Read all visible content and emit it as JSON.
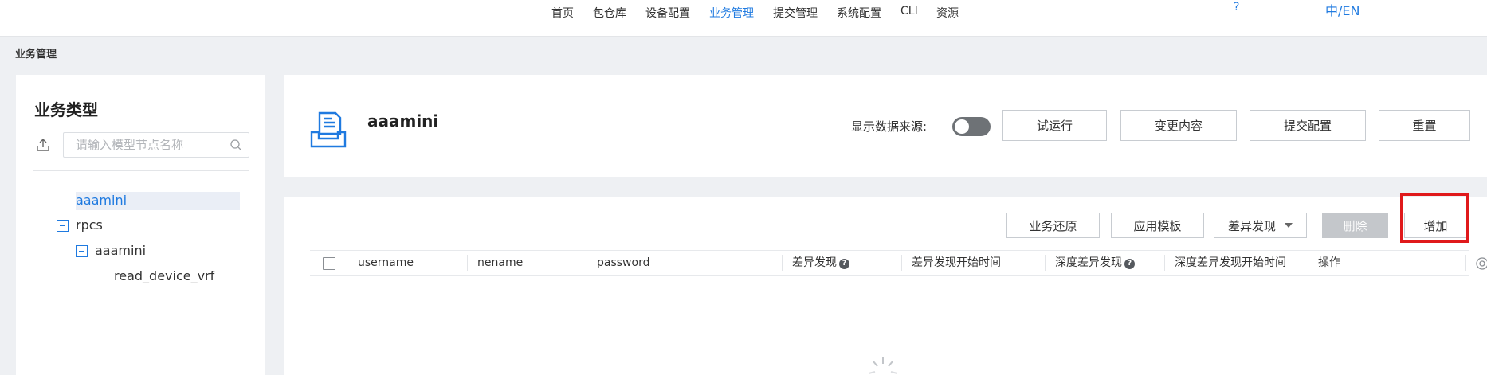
{
  "nav": {
    "items": [
      {
        "label": "首页",
        "active": false
      },
      {
        "label": "包仓库",
        "active": false
      },
      {
        "label": "设备配置",
        "active": false
      },
      {
        "label": "业务管理",
        "active": true
      },
      {
        "label": "提交管理",
        "active": false
      },
      {
        "label": "系统配置",
        "active": false
      },
      {
        "label": "CLI",
        "active": false
      },
      {
        "label": "资源",
        "active": false
      }
    ],
    "help": "?",
    "lang": "中/EN"
  },
  "breadcrumb": "业务管理",
  "sidebar": {
    "title": "业务类型",
    "search_placeholder": "请输入模型节点名称",
    "tree": [
      {
        "label": "aaamini",
        "selected": true
      },
      {
        "label": "rpcs",
        "expanded": true
      },
      {
        "label": "aaamini",
        "expanded": true
      },
      {
        "label": "read_device_vrf"
      }
    ]
  },
  "header": {
    "title": "aaamini",
    "data_source_label": "显示数据来源:",
    "data_source_enabled": false,
    "buttons": {
      "trial_run": "试运行",
      "changes": "变更内容",
      "submit": "提交配置",
      "reset": "重置"
    }
  },
  "toolbar": {
    "restore": "业务还原",
    "apply_template": "应用模板",
    "diff_discovery": "差异发现",
    "delete": "删除",
    "add": "增加"
  },
  "table": {
    "columns": {
      "username": "username",
      "nename": "nename",
      "password": "password",
      "diff": "差异发现",
      "diff_start": "差异发现开始时间",
      "deep_diff": "深度差异发现",
      "deep_diff_start": "深度差异发现开始时间",
      "ops": "操作"
    },
    "help_glyph": "?"
  },
  "colors": {
    "accent": "#1f7ae0",
    "highlight": "#e0191b"
  }
}
